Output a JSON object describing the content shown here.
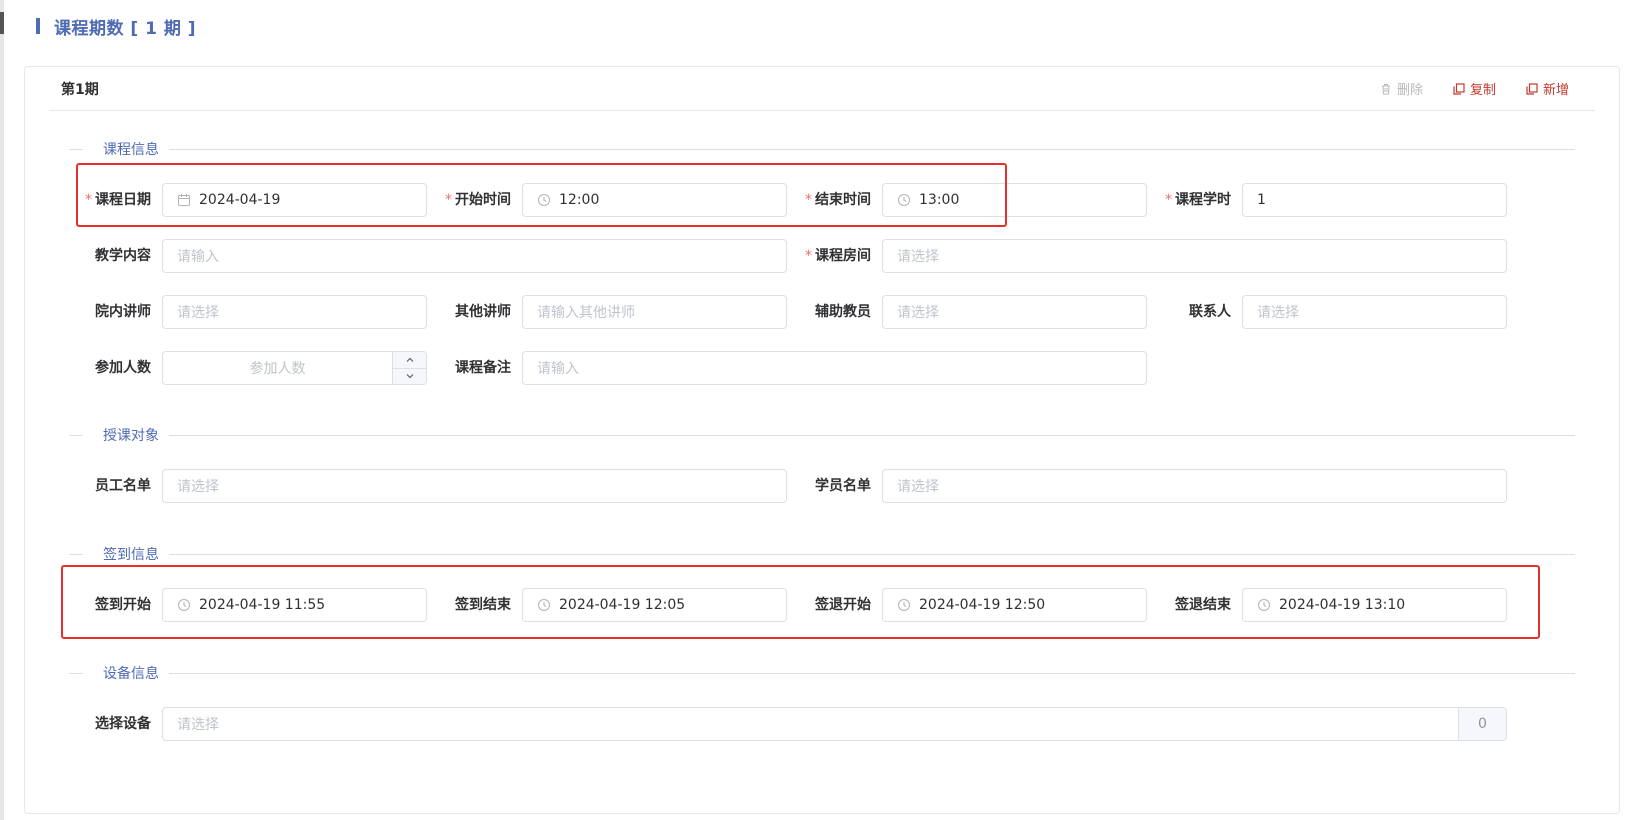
{
  "header": {
    "title": "课程期数 [ 1 期 ]"
  },
  "period": {
    "title": "第1期",
    "actions": {
      "delete": "删除",
      "copy": "复制",
      "add": "新增"
    }
  },
  "sections": {
    "course_info": "课程信息",
    "audience": "授课对象",
    "signin": "签到信息",
    "device": "设备信息"
  },
  "required_mark": "*",
  "course": {
    "date": {
      "label": "课程日期",
      "value": "2024-04-19"
    },
    "start": {
      "label": "开始时间",
      "value": "12:00"
    },
    "end": {
      "label": "结束时间",
      "value": "13:00"
    },
    "hours": {
      "label": "课程学时",
      "value": "1"
    },
    "content": {
      "label": "教学内容",
      "placeholder": "请输入"
    },
    "room": {
      "label": "课程房间",
      "placeholder": "请选择"
    },
    "lecturer": {
      "label": "院内讲师",
      "placeholder": "请选择"
    },
    "other_lecturer": {
      "label": "其他讲师",
      "placeholder": "请输入其他讲师"
    },
    "assistant": {
      "label": "辅助教员",
      "placeholder": "请选择"
    },
    "contact": {
      "label": "联系人",
      "placeholder": "请选择"
    },
    "participants": {
      "label": "参加人数",
      "placeholder": "参加人数"
    },
    "remark": {
      "label": "课程备注",
      "placeholder": "请输入"
    }
  },
  "audience": {
    "staff": {
      "label": "员工名单",
      "placeholder": "请选择"
    },
    "students": {
      "label": "学员名单",
      "placeholder": "请选择"
    }
  },
  "signin": {
    "signin_start": {
      "label": "签到开始",
      "value": "2024-04-19 11:55"
    },
    "signin_end": {
      "label": "签到结束",
      "value": "2024-04-19 12:05"
    },
    "signout_start": {
      "label": "签退开始",
      "value": "2024-04-19 12:50"
    },
    "signout_end": {
      "label": "签退结束",
      "value": "2024-04-19 13:10"
    }
  },
  "device": {
    "select": {
      "label": "选择设备",
      "placeholder": "请选择",
      "count": "0"
    }
  },
  "colors": {
    "accent": "#4e6bb3",
    "danger": "#c0392b",
    "highlight": "#e8302a",
    "required": "#f56c6c"
  }
}
